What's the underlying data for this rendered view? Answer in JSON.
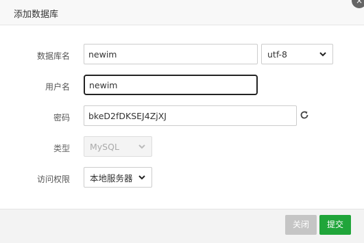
{
  "dialog": {
    "title": "添加数据库",
    "close_symbol": "×"
  },
  "form": {
    "db_name": {
      "label": "数据库名",
      "value": "newim"
    },
    "charset": {
      "value": "utf-8"
    },
    "username": {
      "label": "用户名",
      "value": "newim"
    },
    "password": {
      "label": "密码",
      "value": "bkeD2fDKSEJ4ZjXJ"
    },
    "type": {
      "label": "类型",
      "value": "MySQL"
    },
    "access": {
      "label": "访问权限",
      "value": "本地服务器"
    }
  },
  "footer": {
    "close_label": "关闭",
    "submit_label": "提交"
  },
  "colors": {
    "submit": "#20a53a",
    "close": "#c5c5c5"
  }
}
